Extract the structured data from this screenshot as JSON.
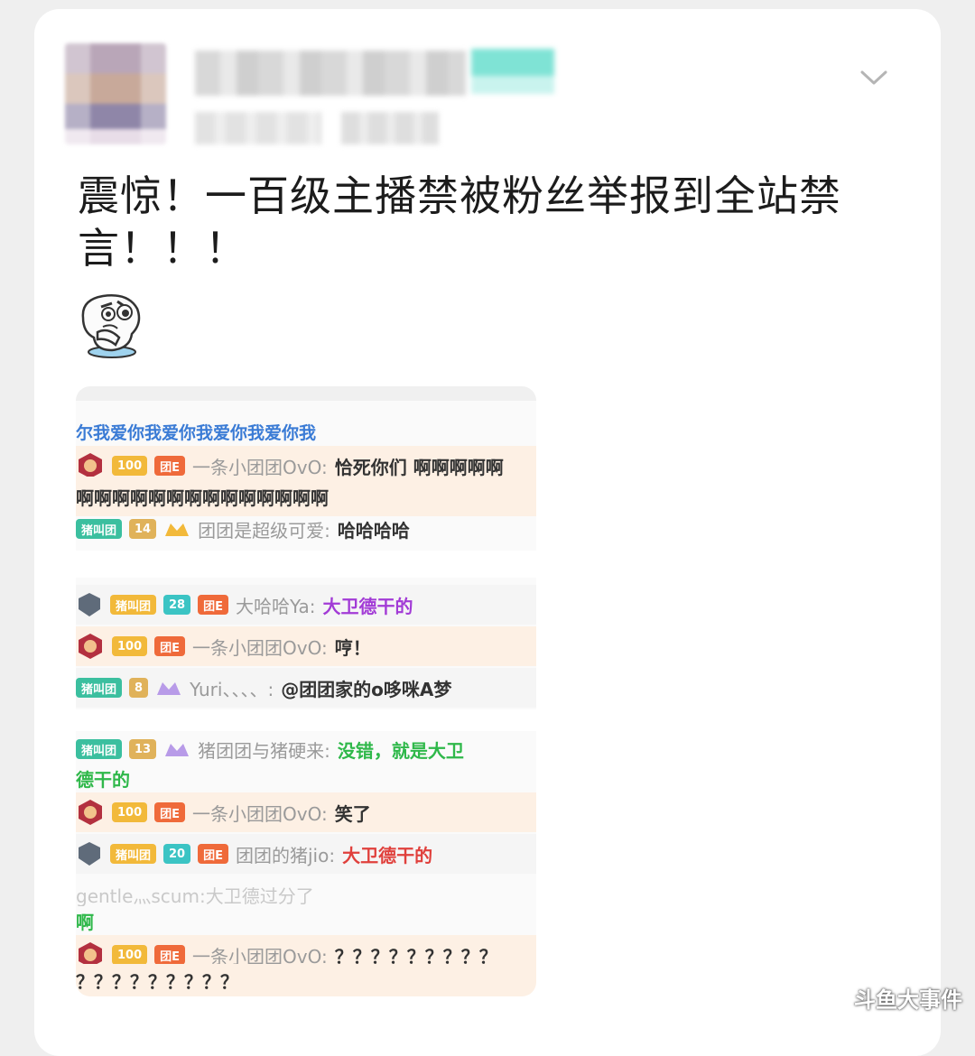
{
  "post": {
    "text": "震惊！一百级主播禁被粉丝举报到全站禁言！！！"
  },
  "chat": {
    "top_line": "尔我爱你我爱你我爱你我爱你我",
    "rows": [
      {
        "level": "100",
        "fan": "团E",
        "user": "一条小团团OvO:",
        "msg": "恰死你们 啊啊啊啊啊"
      },
      {
        "cont": "啊啊啊啊啊啊啊啊啊啊啊啊啊啊"
      },
      {
        "club": "猪叫团",
        "lv": "14",
        "user": "团团是超级可爱:",
        "msg": "哈哈哈哈"
      },
      {
        "club": "猪叫团",
        "lv": "28",
        "fan": "团E",
        "user": "大哈哈Ya:",
        "msg": "大卫德干的"
      },
      {
        "level": "100",
        "fan": "团E",
        "user": "一条小团团OvO:",
        "msg": "哼！"
      },
      {
        "club": "猪叫团",
        "lv": "8",
        "user": "Yuri、、、、:",
        "msg": "@团团家的o哆咪A梦"
      },
      {
        "club": "猪叫团",
        "lv": "13",
        "user": "猪团团与猪硬来:",
        "msg": "没错，就是大卫"
      },
      {
        "cont": "德干的"
      },
      {
        "level": "100",
        "fan": "团E",
        "user": "一条小团团OvO:",
        "msg": "笑了"
      },
      {
        "club": "猪叫团",
        "lv": "20",
        "fan": "团E",
        "user": "团团的猪jio:",
        "msg": "大卫德干的"
      },
      {
        "partial": "gentle灬scum:大卫德过分了"
      },
      {
        "cont": "啊"
      },
      {
        "level": "100",
        "fan": "团E",
        "user": "一条小团团OvO:",
        "msg": "？？？？？？？？？"
      },
      {
        "cont": "？？？？？？？？？"
      }
    ]
  },
  "watermark": "斗鱼大事件",
  "colors": {
    "msg_green": "#2fb84a",
    "msg_purple": "#a23bd6",
    "msg_dark": "#333333",
    "username_gray": "#9a9a9a",
    "highlight_row": "#fdf0e4"
  }
}
